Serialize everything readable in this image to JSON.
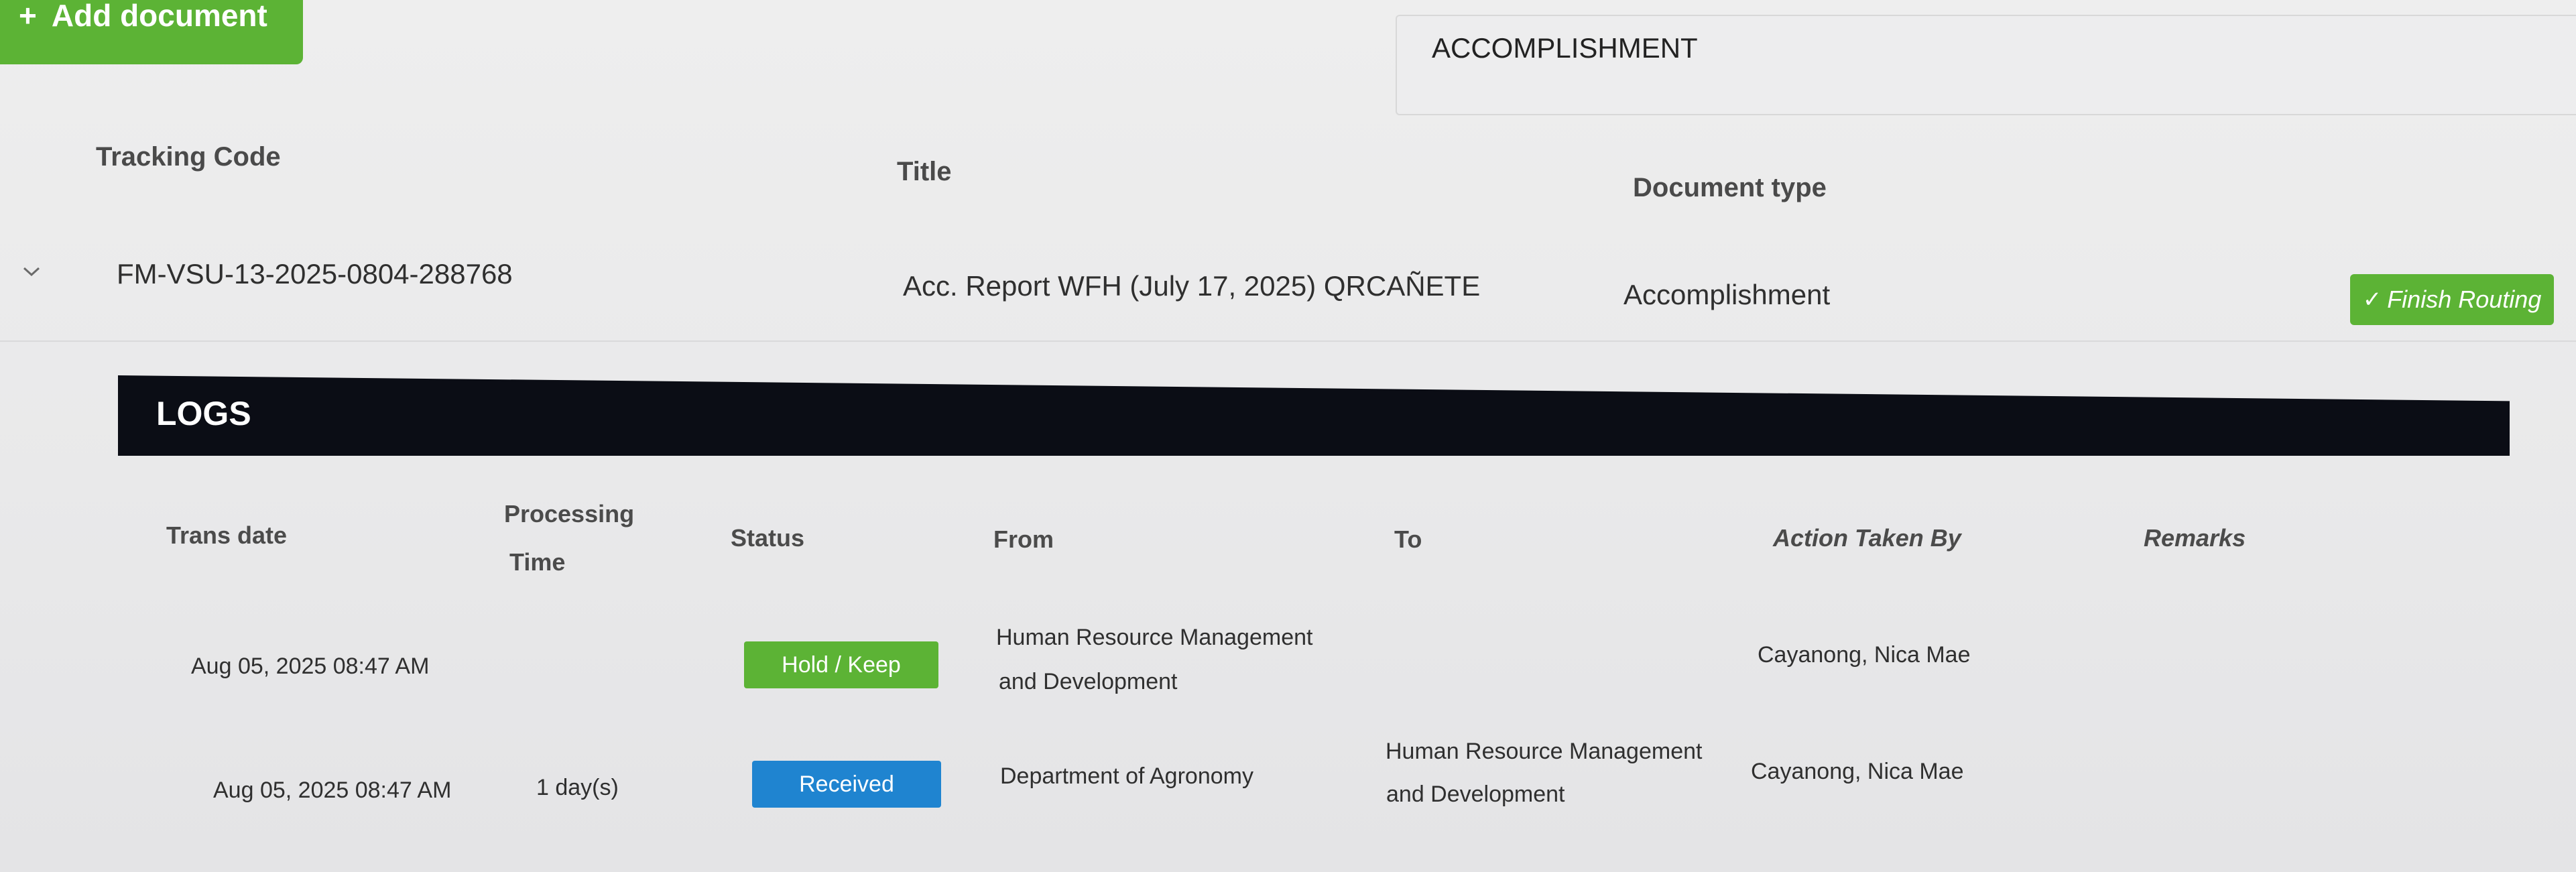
{
  "header": {
    "add_document_label": "Add document",
    "add_icon": "+",
    "document_type_value": "ACCOMPLISHMENT"
  },
  "documents_table": {
    "columns": {
      "tracking_code": "Tracking Code",
      "title": "Title",
      "document_type": "Document type"
    },
    "row": {
      "tracking_code": "FM-VSU-13-2025-0804-288768",
      "title": "Acc. Report WFH (July 17, 2025) QRCAÑETE",
      "document_type": "Accomplishment",
      "finish_button_label": "Finish Routing",
      "finish_icon": "✓"
    }
  },
  "logs": {
    "title": "LOGS",
    "columns": {
      "trans_date": "Trans date",
      "processing_time_line1": "Processing",
      "processing_time_line2": "Time",
      "status": "Status",
      "from": "From",
      "to": "To",
      "action_taken_by": "Action Taken By",
      "remarks": "Remarks"
    },
    "rows": [
      {
        "trans_date": "Aug 05, 2025 08:47 AM",
        "processing_time": "",
        "status": "Hold / Keep",
        "status_color": "#5cb335",
        "from_line1": "Human Resource Management",
        "from_line2": "and Development",
        "to_line1": "",
        "to_line2": "",
        "action_taken_by": "Cayanong, Nica Mae",
        "remarks": ""
      },
      {
        "trans_date": "Aug 05, 2025 08:47 AM",
        "processing_time": "1 day(s)",
        "status": "Received",
        "status_color": "#1f84d0",
        "from_line1": "Department of Agronomy",
        "from_line2": "",
        "to_line1": "Human Resource Management",
        "to_line2": "and Development",
        "action_taken_by": "Cayanong, Nica Mae",
        "remarks": ""
      }
    ]
  },
  "colors": {
    "accent_green": "#5cb335",
    "accent_blue": "#1f84d0",
    "logs_bar": "#0b0d15",
    "background": "#eeeeee"
  }
}
